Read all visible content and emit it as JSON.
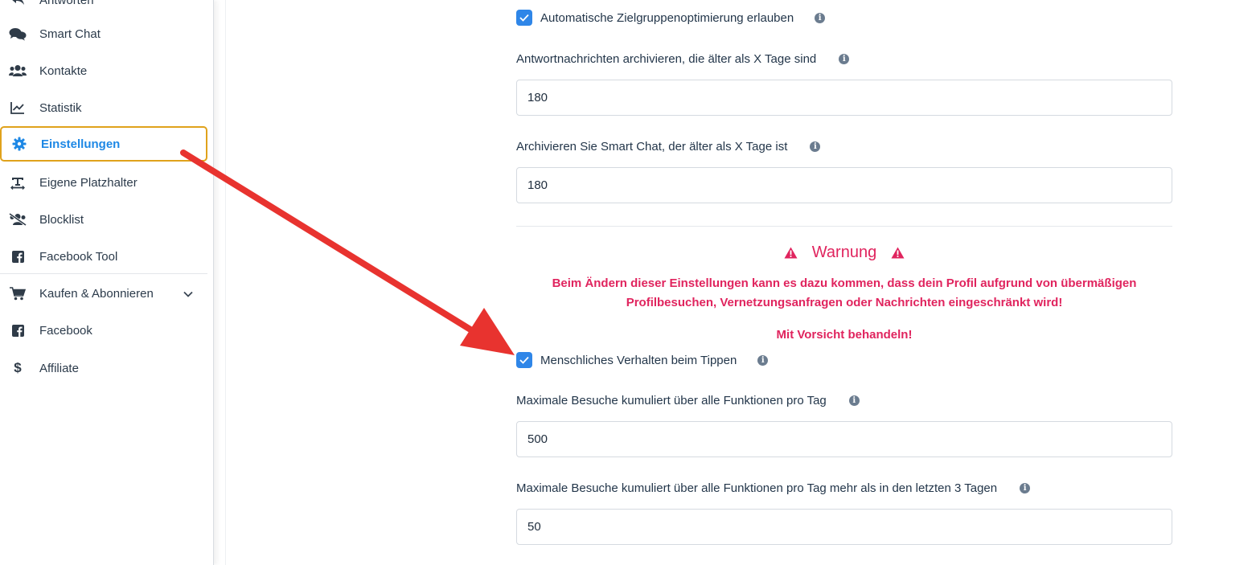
{
  "sidebar": {
    "items": [
      {
        "label": "Antworten",
        "icon": "replies-icon"
      },
      {
        "label": "Smart Chat",
        "icon": "chat-bubbles-icon"
      },
      {
        "label": "Kontakte",
        "icon": "users-icon"
      },
      {
        "label": "Statistik",
        "icon": "line-chart-icon"
      },
      {
        "label": "Einstellungen",
        "icon": "gear-icon",
        "active": true
      },
      {
        "label": "Eigene Platzhalter",
        "icon": "text-format-icon"
      },
      {
        "label": "Blocklist",
        "icon": "users-slash-icon"
      },
      {
        "label": "Facebook Tool",
        "icon": "facebook-square-icon"
      },
      {
        "label": "Kaufen & Abonnieren",
        "icon": "cart-icon"
      },
      {
        "label": "Facebook",
        "icon": "facebook-square-icon"
      },
      {
        "label": "Affiliate",
        "icon": "dollar-icon"
      }
    ],
    "active_color": "#1e88e5",
    "active_border_color": "#e0a21c"
  },
  "settings": {
    "auto_targeting": {
      "label": "Automatische Zielgruppenoptimierung erlauben",
      "checked": true
    },
    "archive_replies": {
      "label": "Antwortnachrichten archivieren, die älter als X Tage sind",
      "value": "180"
    },
    "archive_smartchat": {
      "label": "Archivieren Sie Smart Chat, der älter als X Tage ist",
      "value": "180"
    },
    "warning": {
      "title": "Warnung",
      "line1": "Beim Ändern dieser Einstellungen kann es dazu kommen, dass dein Profil aufgrund von übermäßigen",
      "line2": "Profilbesuchen, Vernetzungsanfragen oder Nachrichten eingeschränkt wird!",
      "caution": "Mit Vorsicht behandeln!",
      "color": "#e0245e"
    },
    "human_typing": {
      "label": "Menschliches Verhalten beim Tippen",
      "checked": true
    },
    "max_visits": {
      "label": "Maximale Besuche kumuliert über alle Funktionen pro Tag",
      "value": "500"
    },
    "max_visits_extra": {
      "label": "Maximale Besuche kumuliert über alle Funktionen pro Tag mehr als in den letzten 3 Tagen",
      "value": "50"
    }
  },
  "annotation": {
    "arrow_color": "#e8332f"
  }
}
